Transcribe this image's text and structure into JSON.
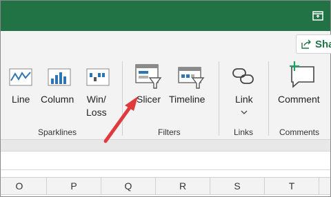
{
  "share": {
    "label": "Sha"
  },
  "sparklines": {
    "group_label": "Sparklines",
    "line_label": "Line",
    "column_label": "Column",
    "winloss_label": "Win/\nLoss"
  },
  "filters": {
    "group_label": "Filters",
    "slicer_label": "Slicer",
    "timeline_label": "Timeline"
  },
  "links": {
    "group_label": "Links",
    "link_label": "Link"
  },
  "comments": {
    "group_label": "Comments",
    "comment_label": "Comment"
  },
  "columns": [
    "O",
    "P",
    "Q",
    "R",
    "S",
    "T"
  ],
  "colors": {
    "titlebar": "#217346",
    "arrow": "#e0393e",
    "accent_green": "#21a366",
    "icon_blue": "#2e75b6"
  },
  "icons": {
    "restore": "restore-window-icon",
    "share": "share-icon",
    "line": "sparkline-line-icon",
    "column": "sparkline-column-icon",
    "winloss": "sparkline-winloss-icon",
    "slicer": "slicer-icon",
    "timeline": "timeline-icon",
    "link": "link-icon",
    "comment": "new-comment-icon"
  }
}
